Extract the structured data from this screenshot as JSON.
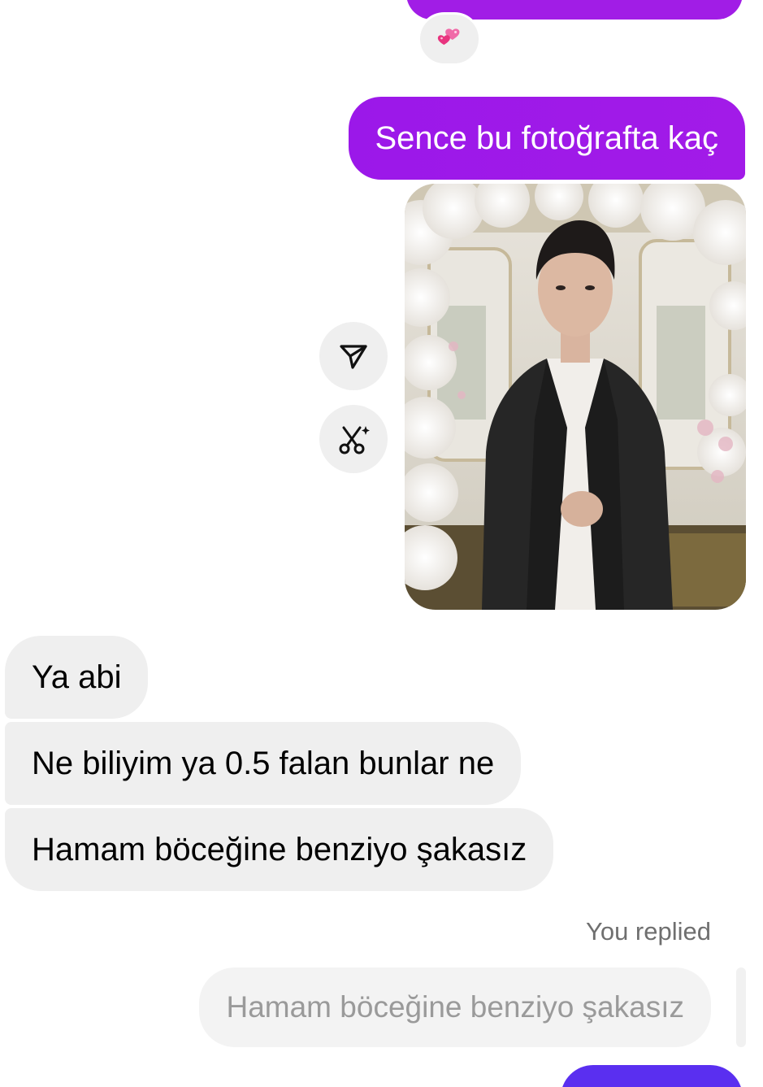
{
  "thread": {
    "reaction_emoji": "two-hearts-emoji",
    "outgoing_message": "Sence bu fotoğrafta kaç",
    "photo": {
      "description_icon": "portrait-photo"
    },
    "incoming_messages": [
      "Ya abi",
      "Ne biliyim ya 0.5 falan bunlar ne",
      "Hamam böceğine benziyo şakasız"
    ],
    "reply": {
      "label": "You replied",
      "quoted_text": "Hamam böceğine benziyo şakasız"
    }
  },
  "icons": {
    "share": "send-icon",
    "ai_edit": "scissors-sparkle-icon"
  },
  "colors": {
    "outgoing_bubble": "#a11de6",
    "incoming_bubble": "#efefef",
    "bottom_bubble": "#5a2ff0"
  }
}
